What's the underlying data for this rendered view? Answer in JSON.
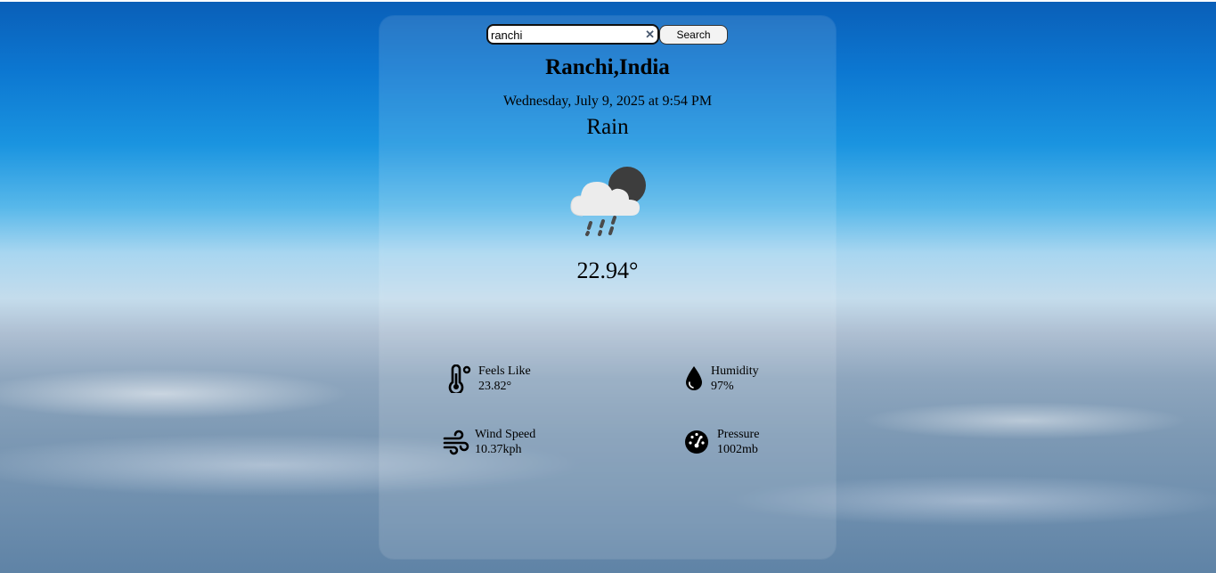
{
  "search": {
    "value": "ranchi",
    "clear_symbol": "✕",
    "button_label": "Search"
  },
  "location": "Ranchi,India",
  "datetime": "Wednesday, July 9, 2025 at 9:54 PM",
  "condition": "Rain",
  "condition_icon": "cloud-rain-moon-icon",
  "temperature": "22.94°",
  "stats": {
    "feels_like": {
      "label": "Feels Like",
      "value": "23.82°",
      "icon": "thermometer-icon"
    },
    "humidity": {
      "label": "Humidity",
      "value": "97%",
      "icon": "water-drop-icon"
    },
    "wind_speed": {
      "label": "Wind Speed",
      "value": "10.37kph",
      "icon": "wind-icon"
    },
    "pressure": {
      "label": "Pressure",
      "value": "1002mb",
      "icon": "gauge-icon"
    }
  }
}
